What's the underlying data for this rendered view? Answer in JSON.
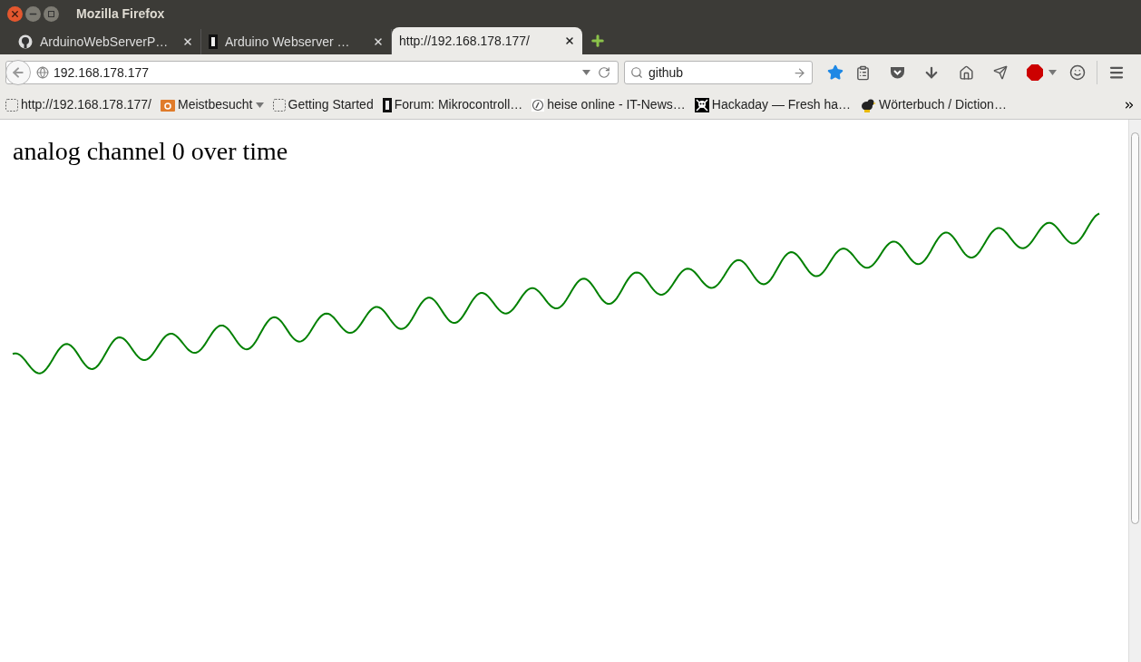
{
  "window": {
    "title": "Mozilla Firefox"
  },
  "tabs": [
    {
      "label": "ArduinoWebServerP…",
      "selected": false,
      "kind": "github"
    },
    {
      "label": "Arduino Webserver …",
      "selected": false,
      "kind": "chip"
    },
    {
      "label": "http://192.168.178.177/",
      "selected": true,
      "kind": "none"
    }
  ],
  "address_bar": {
    "value": "192.168.178.177"
  },
  "search": {
    "value": "github"
  },
  "bookmarks": [
    {
      "label": "http://192.168.178.177/",
      "kind": "blank"
    },
    {
      "label": "Meistbesucht",
      "kind": "folder"
    },
    {
      "label": "Getting Started",
      "kind": "blank"
    },
    {
      "label": "Forum: Mikrocontroll…",
      "kind": "chip"
    },
    {
      "label": "heise online - IT-News…",
      "kind": "heise"
    },
    {
      "label": "Hackaday — Fresh ha…",
      "kind": "skull"
    },
    {
      "label": "Wörterbuch / Diction…",
      "kind": "bird"
    }
  ],
  "page": {
    "heading": "analog channel 0 over time"
  }
}
